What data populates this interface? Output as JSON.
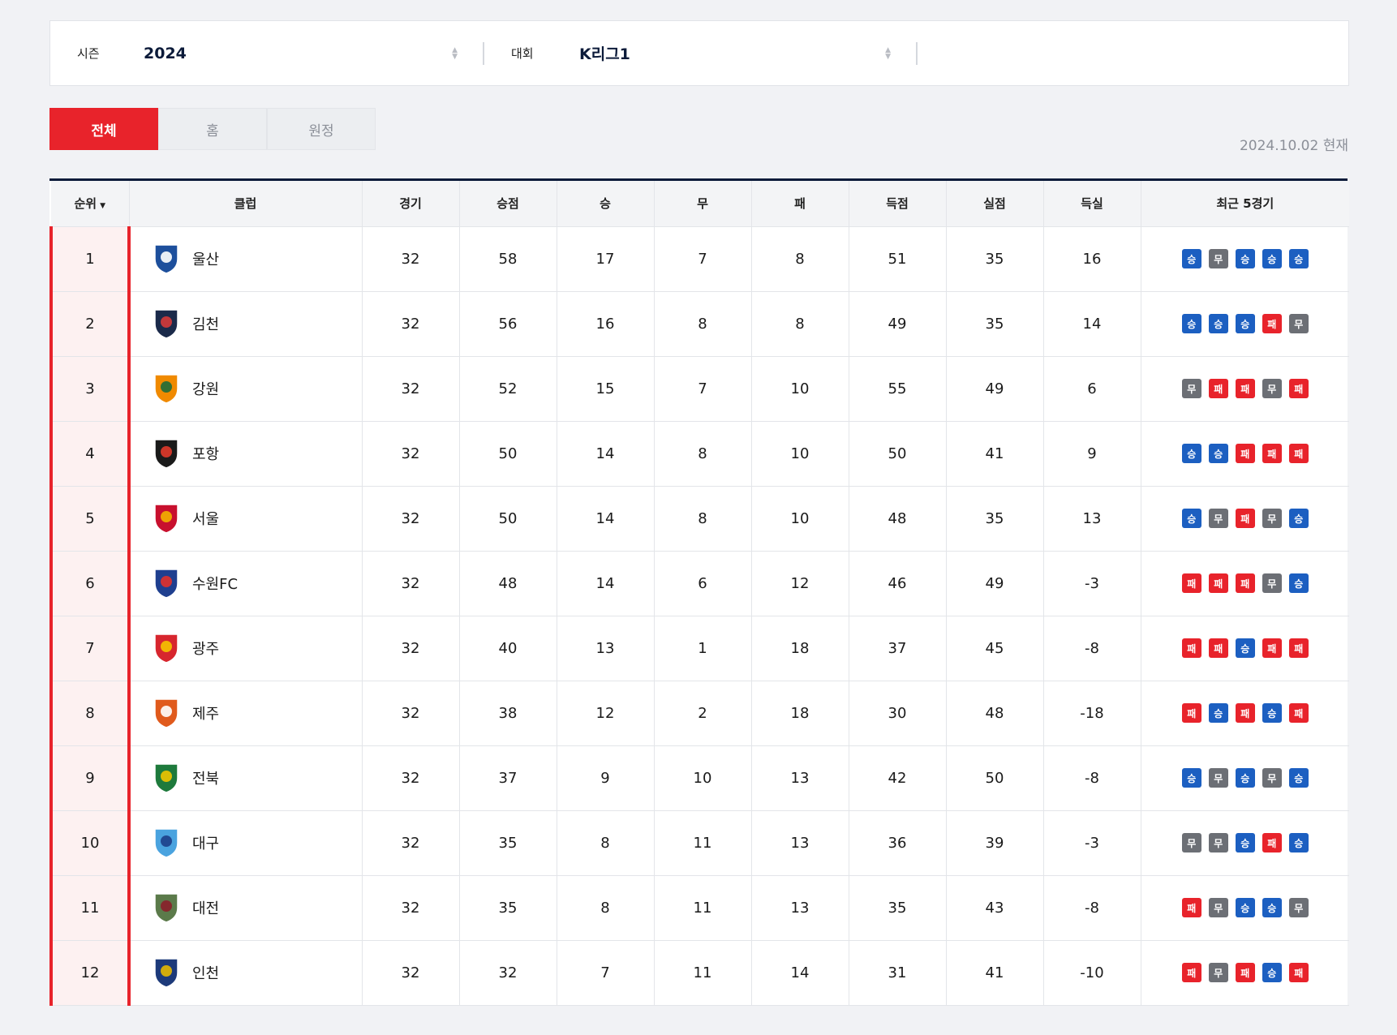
{
  "filters": {
    "season": {
      "label": "시즌",
      "value": "2024"
    },
    "competition": {
      "label": "대회",
      "value": "K리그1"
    }
  },
  "tabs": [
    {
      "label": "전체",
      "active": true
    },
    {
      "label": "홈",
      "active": false
    },
    {
      "label": "원정",
      "active": false
    }
  ],
  "as_of": "2024.10.02 현재",
  "table": {
    "headers": {
      "rank": "순위",
      "club": "클럽",
      "played": "경기",
      "points": "승점",
      "won": "승",
      "drawn": "무",
      "lost": "패",
      "gf": "득점",
      "ga": "실점",
      "gd": "득실",
      "form": "최근 5경기"
    },
    "form_labels": {
      "W": "승",
      "D": "무",
      "L": "패"
    },
    "rows": [
      {
        "rank": "1",
        "club": "울산",
        "emblem": "ulsan-emblem",
        "played": "32",
        "points": "58",
        "won": "17",
        "drawn": "7",
        "lost": "8",
        "gf": "51",
        "ga": "35",
        "gd": "16",
        "form": [
          "W",
          "D",
          "W",
          "W",
          "W"
        ]
      },
      {
        "rank": "2",
        "club": "김천",
        "emblem": "gimcheon-emblem",
        "played": "32",
        "points": "56",
        "won": "16",
        "drawn": "8",
        "lost": "8",
        "gf": "49",
        "ga": "35",
        "gd": "14",
        "form": [
          "W",
          "W",
          "W",
          "L",
          "D"
        ]
      },
      {
        "rank": "3",
        "club": "강원",
        "emblem": "gangwon-emblem",
        "played": "32",
        "points": "52",
        "won": "15",
        "drawn": "7",
        "lost": "10",
        "gf": "55",
        "ga": "49",
        "gd": "6",
        "form": [
          "D",
          "L",
          "L",
          "D",
          "L"
        ]
      },
      {
        "rank": "4",
        "club": "포항",
        "emblem": "pohang-emblem",
        "played": "32",
        "points": "50",
        "won": "14",
        "drawn": "8",
        "lost": "10",
        "gf": "50",
        "ga": "41",
        "gd": "9",
        "form": [
          "W",
          "W",
          "L",
          "L",
          "L"
        ]
      },
      {
        "rank": "5",
        "club": "서울",
        "emblem": "seoul-emblem",
        "played": "32",
        "points": "50",
        "won": "14",
        "drawn": "8",
        "lost": "10",
        "gf": "48",
        "ga": "35",
        "gd": "13",
        "form": [
          "W",
          "D",
          "L",
          "D",
          "W"
        ]
      },
      {
        "rank": "6",
        "club": "수원FC",
        "emblem": "suwonfc-emblem",
        "played": "32",
        "points": "48",
        "won": "14",
        "drawn": "6",
        "lost": "12",
        "gf": "46",
        "ga": "49",
        "gd": "-3",
        "form": [
          "L",
          "L",
          "L",
          "D",
          "W"
        ]
      },
      {
        "rank": "7",
        "club": "광주",
        "emblem": "gwangju-emblem",
        "played": "32",
        "points": "40",
        "won": "13",
        "drawn": "1",
        "lost": "18",
        "gf": "37",
        "ga": "45",
        "gd": "-8",
        "form": [
          "L",
          "L",
          "W",
          "L",
          "L"
        ]
      },
      {
        "rank": "8",
        "club": "제주",
        "emblem": "jeju-emblem",
        "played": "32",
        "points": "38",
        "won": "12",
        "drawn": "2",
        "lost": "18",
        "gf": "30",
        "ga": "48",
        "gd": "-18",
        "form": [
          "L",
          "W",
          "L",
          "W",
          "L"
        ]
      },
      {
        "rank": "9",
        "club": "전북",
        "emblem": "jeonbuk-emblem",
        "played": "32",
        "points": "37",
        "won": "9",
        "drawn": "10",
        "lost": "13",
        "gf": "42",
        "ga": "50",
        "gd": "-8",
        "form": [
          "W",
          "D",
          "W",
          "D",
          "W"
        ]
      },
      {
        "rank": "10",
        "club": "대구",
        "emblem": "daegu-emblem",
        "played": "32",
        "points": "35",
        "won": "8",
        "drawn": "11",
        "lost": "13",
        "gf": "36",
        "ga": "39",
        "gd": "-3",
        "form": [
          "D",
          "D",
          "W",
          "L",
          "W"
        ]
      },
      {
        "rank": "11",
        "club": "대전",
        "emblem": "daejeon-emblem",
        "played": "32",
        "points": "35",
        "won": "8",
        "drawn": "11",
        "lost": "13",
        "gf": "35",
        "ga": "43",
        "gd": "-8",
        "form": [
          "L",
          "D",
          "W",
          "W",
          "D"
        ]
      },
      {
        "rank": "12",
        "club": "인천",
        "emblem": "incheon-emblem",
        "played": "32",
        "points": "32",
        "won": "7",
        "drawn": "11",
        "lost": "14",
        "gf": "31",
        "ga": "41",
        "gd": "-10",
        "form": [
          "L",
          "D",
          "L",
          "W",
          "L"
        ]
      }
    ]
  },
  "colors": {
    "accent_red": "#e8232b",
    "navy": "#0c1b3a",
    "win_blue": "#1c5fc1",
    "draw_gray": "#6c6f75",
    "loss_red": "#e8232b"
  }
}
